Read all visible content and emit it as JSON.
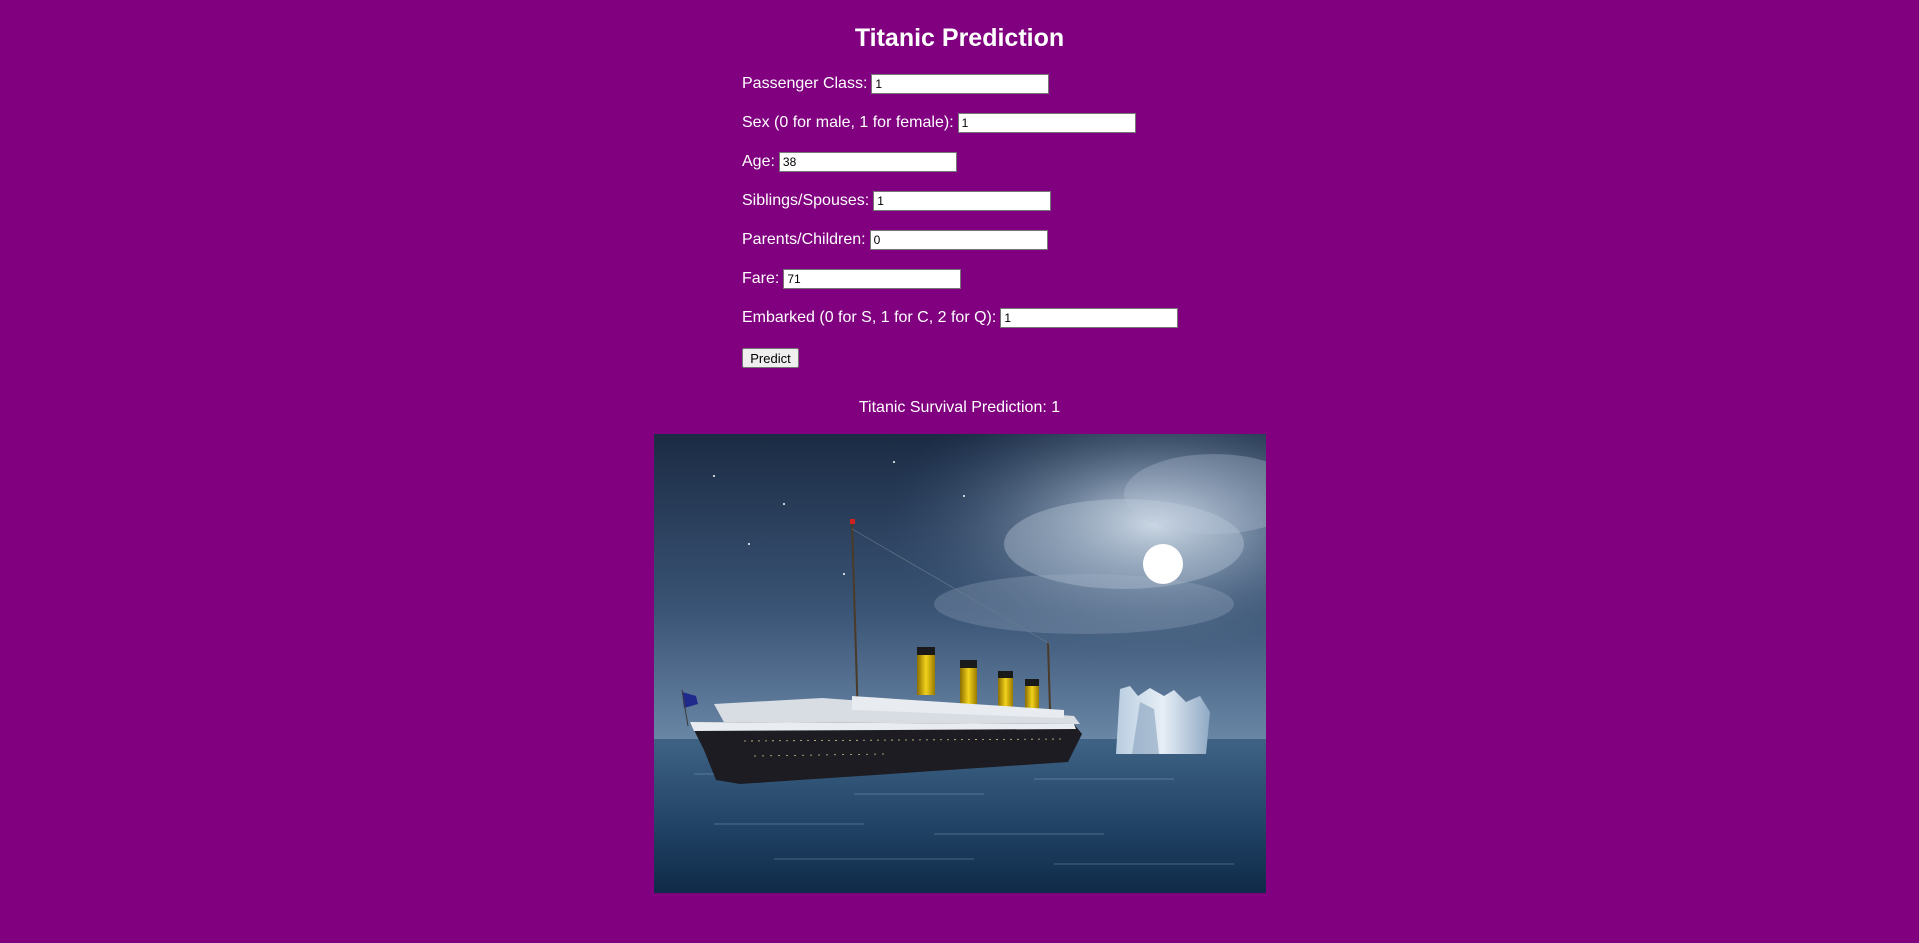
{
  "page": {
    "title": "Titanic Prediction"
  },
  "form": {
    "fields": [
      {
        "label": "Passenger Class:",
        "value": "1"
      },
      {
        "label": "Sex (0 for male, 1 for female):",
        "value": "1"
      },
      {
        "label": "Age:",
        "value": "38"
      },
      {
        "label": "Siblings/Spouses:",
        "value": "1"
      },
      {
        "label": "Parents/Children:",
        "value": "0"
      },
      {
        "label": "Fare:",
        "value": "71"
      },
      {
        "label": "Embarked (0 for S, 1 for C, 2 for Q):",
        "value": "1"
      }
    ],
    "submit_label": "Predict"
  },
  "result": {
    "text": "Titanic Survival Prediction: 1"
  },
  "colors": {
    "background": "#800080",
    "text": "#ffffff"
  },
  "image": {
    "subject": "titanic-ship-and-iceberg-at-night"
  }
}
